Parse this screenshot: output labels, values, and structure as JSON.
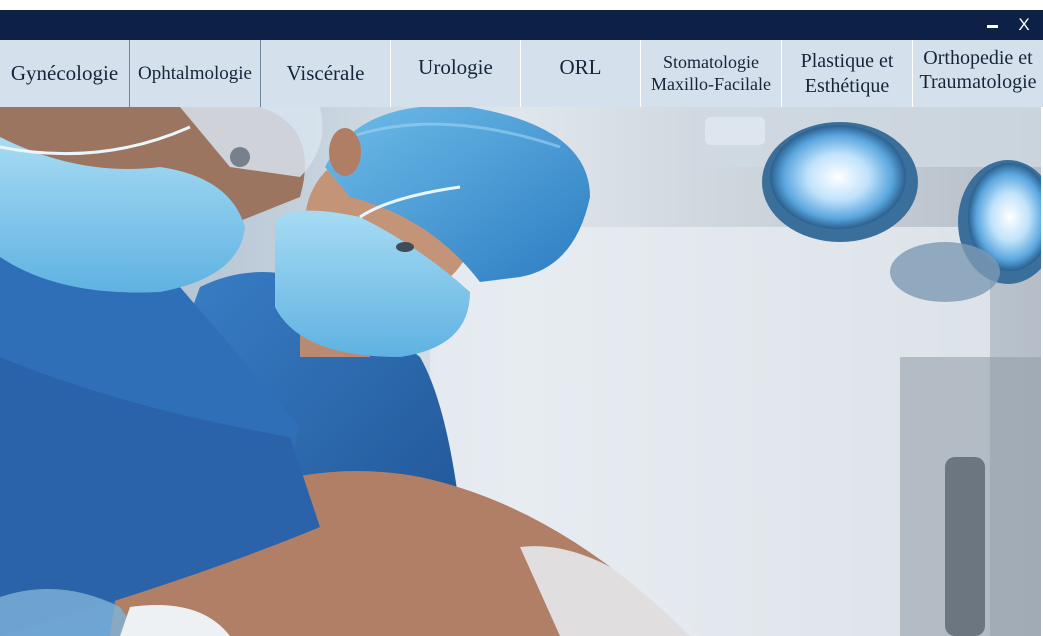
{
  "window": {
    "minimize_icon": "minimize-icon",
    "close_label": "X"
  },
  "menu": {
    "tabs": [
      {
        "lines": [
          "Gynécologie"
        ]
      },
      {
        "lines": [
          "Ophtalmologie"
        ]
      },
      {
        "lines": [
          "Viscérale"
        ]
      },
      {
        "lines": [
          "Urologie"
        ]
      },
      {
        "lines": [
          "ORL"
        ]
      },
      {
        "lines": [
          "Stomatologie",
          "Maxillo-Facilale"
        ]
      },
      {
        "lines": [
          "Plastique et",
          "Esthétique"
        ]
      },
      {
        "lines": [
          "Orthopedie et",
          "Traumatologie"
        ]
      }
    ]
  },
  "hero": {
    "image": "surgeons-operating-photo",
    "colors": {
      "scrubs": "#2f6fb8",
      "cap": "#4a9fdb",
      "mask": "#7cc3ec",
      "skin": "#b98a72",
      "wall": "#dfe6ec"
    }
  },
  "colors": {
    "titlebar": "#0d2146",
    "menubar": "#d4e1ec",
    "menu_text": "#17243a"
  }
}
